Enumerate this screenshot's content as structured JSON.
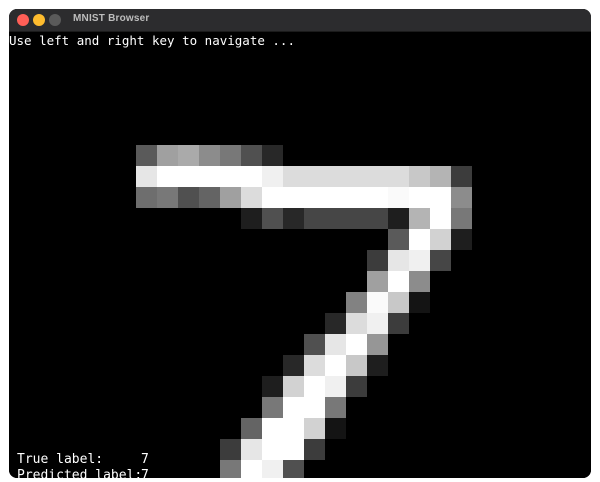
{
  "window": {
    "title": "MNIST Browser",
    "controls": {
      "close_color": "#ff5f57",
      "minimize_color": "#febc2e",
      "zoom_color": "#5a5a5a"
    }
  },
  "canvas": {
    "instructions": "Use left and right key to navigate ...",
    "digit": {
      "icon": "handwritten-digit-7",
      "grid_width": 16,
      "grid_height": 16,
      "pixels": [
        [
          0,
          0,
          0,
          0,
          0,
          0,
          0,
          0,
          0,
          0,
          0,
          0,
          0,
          0,
          0,
          0,
          0,
          0,
          0,
          0,
          0,
          0,
          0,
          0
        ],
        [
          0,
          0,
          0,
          0,
          0,
          0,
          0,
          0,
          0,
          0,
          0,
          0,
          0,
          0,
          0,
          0,
          0,
          0,
          0,
          0,
          0,
          0,
          0,
          0
        ]
      ]
    },
    "true_label_key": "True label:",
    "true_label_value": "7",
    "predicted_label_key": "Predicted label:",
    "predicted_label_value": "7"
  }
}
